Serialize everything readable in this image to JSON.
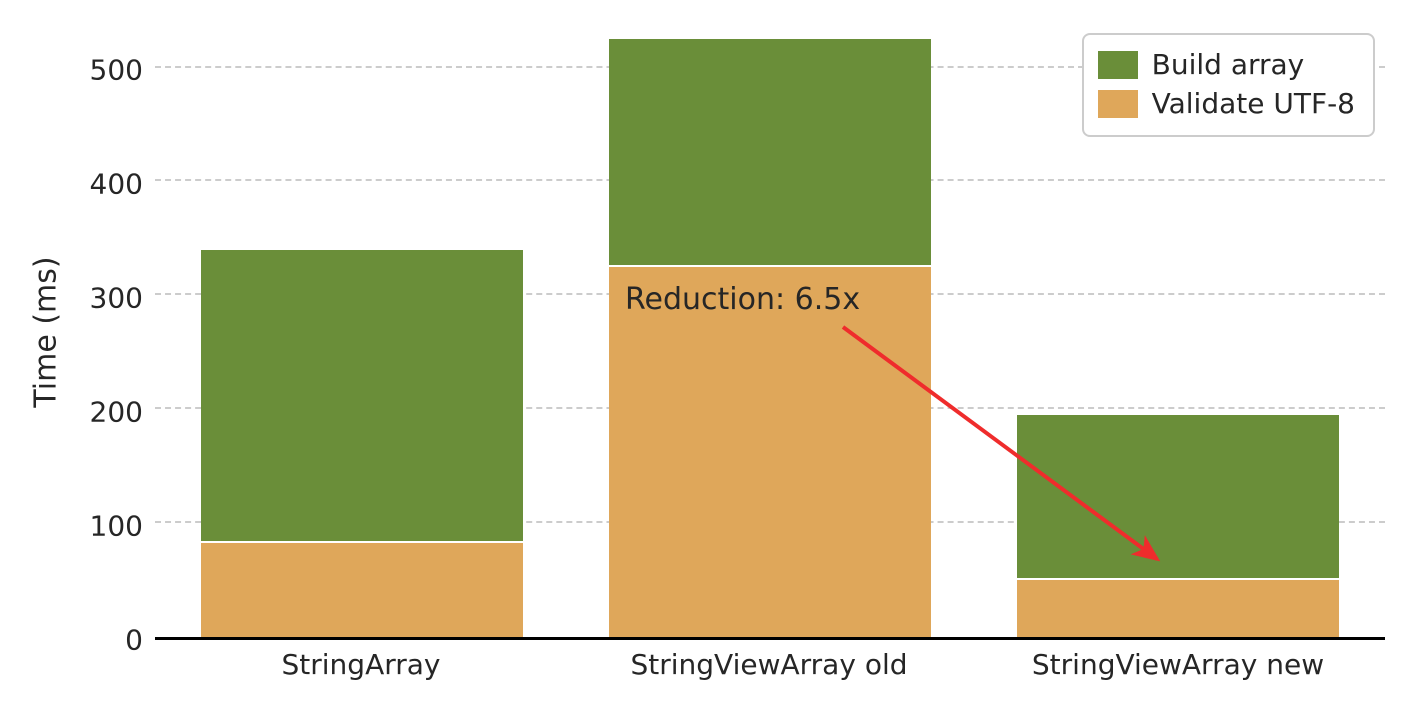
{
  "chart_data": {
    "type": "bar",
    "stacked": true,
    "categories": [
      "StringArray",
      "StringViewArray old",
      "StringViewArray new"
    ],
    "series": [
      {
        "name": "Validate UTF-8",
        "color": "#dfa75a",
        "values": [
          83,
          325,
          50
        ]
      },
      {
        "name": "Build array",
        "color": "#6a8e39",
        "values": [
          257,
          200,
          145
        ]
      }
    ],
    "totals": [
      340,
      525,
      195
    ],
    "ylabel": "Time (ms)",
    "xlabel": "",
    "ylim": [
      0,
      540
    ],
    "yticks": [
      0,
      100,
      200,
      300,
      400,
      500
    ],
    "annotation": {
      "text": "Reduction: 6.5x",
      "arrow_color": "#ef2c2c",
      "from_category": "StringViewArray old",
      "to_category": "StringViewArray new"
    },
    "legend_position": "upper right"
  },
  "colors": {
    "build": "#6a8e39",
    "validate": "#dfa75a",
    "arrow": "#ef2c2c",
    "grid": "#cccccc",
    "axis": "#000000"
  }
}
